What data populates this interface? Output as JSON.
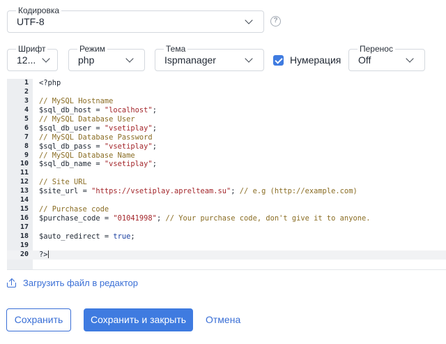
{
  "encoding": {
    "label": "Кодировка",
    "value": "UTF-8",
    "help_icon": "question-circle-icon"
  },
  "settings": {
    "font": {
      "label": "Шрифт",
      "value": "12..."
    },
    "mode": {
      "label": "Режим",
      "value": "php"
    },
    "theme": {
      "label": "Тема",
      "value": "Ispmanager"
    },
    "numbering": {
      "label": "Нумерация",
      "checked": true
    },
    "wrap": {
      "label": "Перенос",
      "value": "Off"
    }
  },
  "editor": {
    "active_line": 20,
    "lines": [
      [
        {
          "t": "def",
          "v": "<?php"
        }
      ],
      [],
      [
        {
          "t": "com",
          "v": "// MySQL Hostname"
        }
      ],
      [
        {
          "t": "var",
          "v": "$sql_db_host"
        },
        {
          "t": "def",
          "v": " = "
        },
        {
          "t": "str",
          "v": "\"localhost\""
        },
        {
          "t": "def",
          "v": ";"
        }
      ],
      [
        {
          "t": "com",
          "v": "// MySQL Database User"
        }
      ],
      [
        {
          "t": "var",
          "v": "$sql_db_user"
        },
        {
          "t": "def",
          "v": " = "
        },
        {
          "t": "str",
          "v": "\"vsetiplay\""
        },
        {
          "t": "def",
          "v": ";"
        }
      ],
      [
        {
          "t": "com",
          "v": "// MySQL Database Password"
        }
      ],
      [
        {
          "t": "var",
          "v": "$sql_db_pass"
        },
        {
          "t": "def",
          "v": " = "
        },
        {
          "t": "str",
          "v": "\"vsetiplay\""
        },
        {
          "t": "def",
          "v": ";"
        }
      ],
      [
        {
          "t": "com",
          "v": "// MySQL Database Name"
        }
      ],
      [
        {
          "t": "var",
          "v": "$sql_db_name"
        },
        {
          "t": "def",
          "v": " = "
        },
        {
          "t": "str",
          "v": "\"vsetiplay\""
        },
        {
          "t": "def",
          "v": ";"
        }
      ],
      [],
      [
        {
          "t": "com",
          "v": "// Site URL"
        }
      ],
      [
        {
          "t": "var",
          "v": "$site_url"
        },
        {
          "t": "def",
          "v": " = "
        },
        {
          "t": "str",
          "v": "\"https://vsetiplay.aprelteam.su\""
        },
        {
          "t": "def",
          "v": "; "
        },
        {
          "t": "com",
          "v": "// e.g (http://example.com)"
        }
      ],
      [],
      [
        {
          "t": "com",
          "v": "// Purchase code"
        }
      ],
      [
        {
          "t": "var",
          "v": "$purchase_code"
        },
        {
          "t": "def",
          "v": " = "
        },
        {
          "t": "str",
          "v": "\"01041998\""
        },
        {
          "t": "def",
          "v": "; "
        },
        {
          "t": "com",
          "v": "// Your purchase code, don't give it to anyone."
        }
      ],
      [],
      [
        {
          "t": "var",
          "v": "$auto_redirect"
        },
        {
          "t": "def",
          "v": " = "
        },
        {
          "t": "kw",
          "v": "true"
        },
        {
          "t": "def",
          "v": ";"
        }
      ],
      [],
      [
        {
          "t": "def",
          "v": "?>"
        }
      ]
    ]
  },
  "upload": {
    "label": "Загрузить файл в редактор",
    "icon": "upload-icon"
  },
  "actions": {
    "save": "Сохранить",
    "save_close": "Сохранить и закрыть",
    "cancel": "Отмена"
  },
  "colors": {
    "accent": "#3f7be0",
    "link": "#3a6fd6",
    "string": "#a3262b",
    "comment": "#8a6d24",
    "keyword": "#1a3fa0"
  }
}
